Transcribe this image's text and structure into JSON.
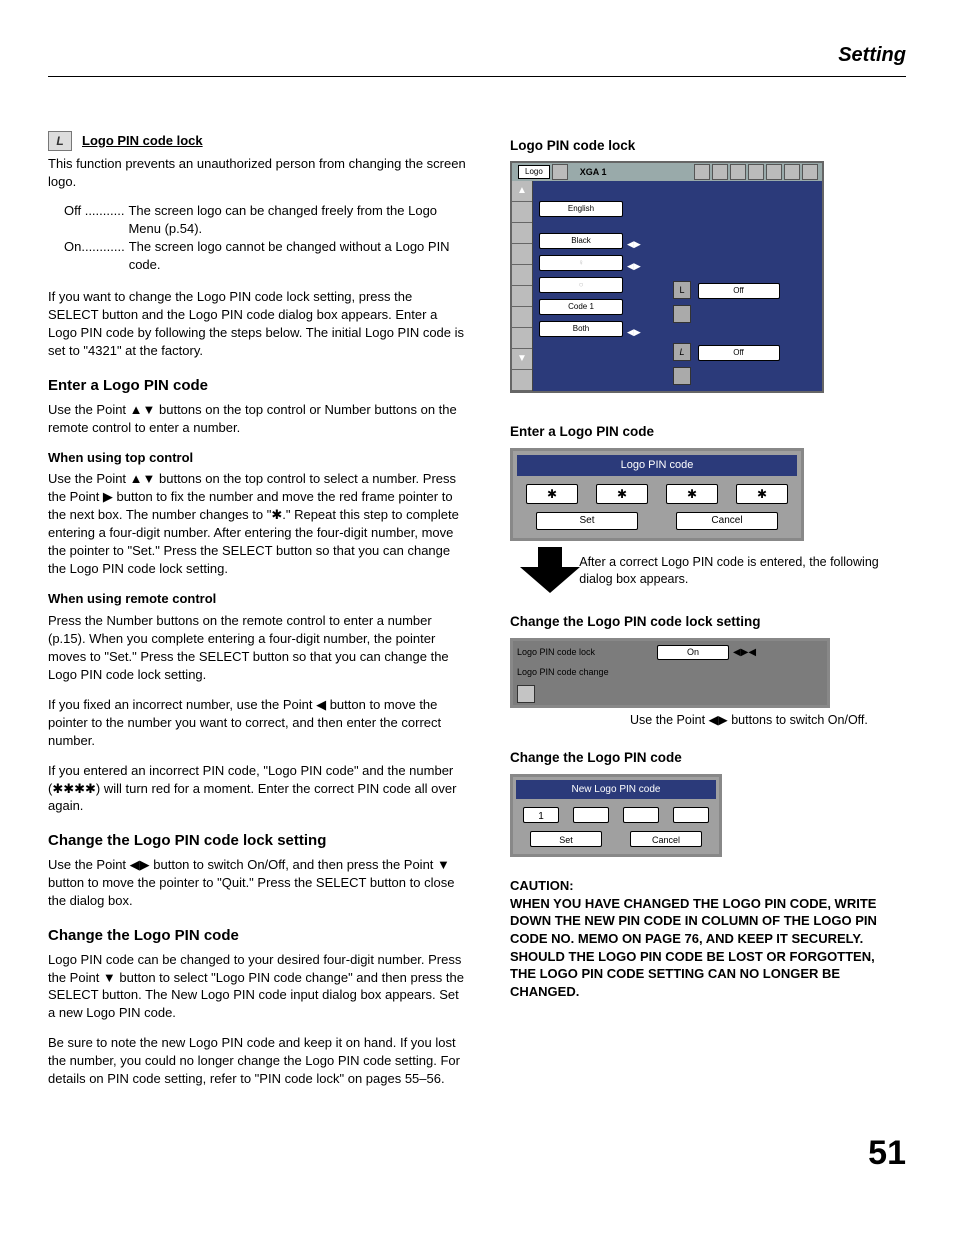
{
  "header": "Setting",
  "page_number": "51",
  "left": {
    "title1": "Logo PIN code lock",
    "intro": "This function prevents an unauthorized person from changing the screen logo.",
    "offDots": "Off ...........",
    "offDesc": "The screen logo can be changed freely from the Logo Menu (p.54).",
    "onDots": "On............",
    "onDesc": "The screen logo cannot be changed without a Logo PIN code.",
    "para1": "If you want to change the Logo PIN code lock setting, press the SELECT button and the Logo PIN code dialog box appears. Enter a Logo PIN code by following the steps below. The initial Logo PIN code is set to \"4321\" at the factory.",
    "h_enter": "Enter a Logo PIN code",
    "enter_intro": "Use the Point ▲▼ buttons on the top control or Number buttons on the remote control to enter a number.",
    "sub_top": "When using top control",
    "top_control": "Use the Point ▲▼ buttons on the top control to select a number. Press the Point ▶ button to fix the number and move the red frame pointer to the next box. The number changes to \"✱.\" Repeat this step to complete entering a four-digit number. After entering the four-digit number, move the pointer to \"Set.\" Press the SELECT button so that you can change the Logo PIN code lock setting.",
    "sub_remote": "When using remote control",
    "remote1": "Press the Number buttons on the remote control to enter a number (p.15). When you complete entering a four-digit number, the pointer moves to \"Set.\" Press the SELECT button so that you can change the Logo PIN code lock setting.",
    "remote2": "If you fixed an incorrect number, use the Point ◀ button to move the pointer to the number you want to correct, and then enter the correct number.",
    "remote3": "If you entered an incorrect PIN code, \"Logo PIN code\" and the number (✱✱✱✱) will turn red for a moment. Enter the correct PIN code all over again.",
    "h_change_setting": "Change the Logo PIN code lock setting",
    "change_setting": "Use the Point ◀▶ button to switch On/Off, and then press the Point ▼ button to move the pointer to \"Quit.\" Press the SELECT button to close the dialog box.",
    "h_change_code": "Change the Logo PIN code",
    "change_code1": "Logo PIN code can be changed to your desired four-digit number. Press the Point ▼ button to select \"Logo PIN code change\" and then press the SELECT button. The New Logo PIN code input dialog box appears. Set a new Logo PIN code.",
    "change_code2": "Be sure to note the new Logo PIN code and keep it on hand. If you lost the number, you could no longer change the Logo PIN code setting. For details on PIN code setting, refer to \"PIN code lock\" on pages 55–56."
  },
  "right": {
    "h1": "Logo PIN code lock",
    "osd": {
      "logo": "Logo",
      "mode": "XGA 1",
      "items": [
        "English",
        "Black",
        "",
        "",
        "Code 1",
        "Both"
      ],
      "off1": "Off",
      "off2": "Off"
    },
    "h2": "Enter a Logo PIN code",
    "pin": {
      "title": "Logo PIN code",
      "box": "✱",
      "set": "Set",
      "cancel": "Cancel"
    },
    "arrow_note": "After a correct Logo PIN code is entered, the following dialog box appears.",
    "h3": "Change the Logo PIN code lock setting",
    "lock": {
      "row1": "Logo PIN code lock",
      "val": "On",
      "row2": "Logo PIN code change"
    },
    "use_note": "Use the Point ◀▶ buttons to switch On/Off.",
    "h4": "Change the Logo PIN code",
    "newpin": {
      "title": "New Logo PIN code",
      "first": "1",
      "set": "Set",
      "cancel": "Cancel"
    },
    "caution_h": "CAUTION:",
    "caution": "WHEN YOU HAVE CHANGED THE LOGO PIN CODE, WRITE DOWN THE NEW PIN CODE IN COLUMN OF THE LOGO PIN CODE NO. MEMO ON PAGE 76, AND KEEP IT SECURELY. SHOULD THE LOGO PIN CODE BE LOST OR FORGOTTEN, THE LOGO PIN CODE SETTING CAN NO LONGER BE CHANGED."
  }
}
